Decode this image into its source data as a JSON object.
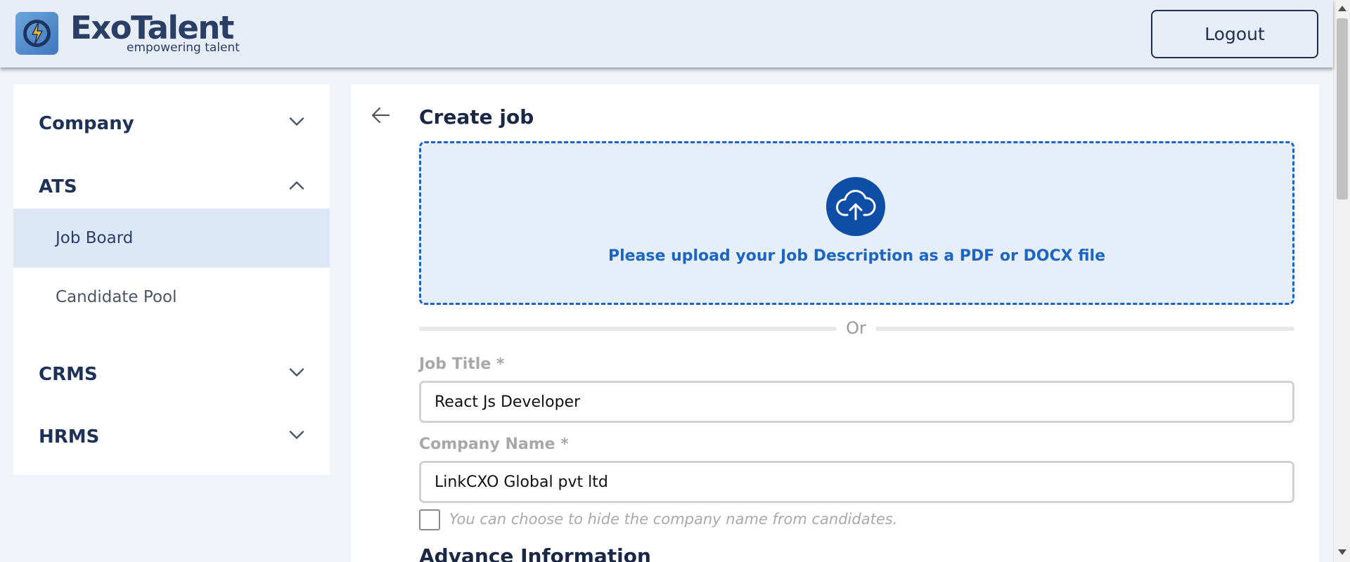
{
  "app": {
    "brand_name": "ExoTalent",
    "tagline": "empowering talent"
  },
  "header": {
    "logout_label": "Logout"
  },
  "sidebar": {
    "sections": [
      {
        "label": "Company",
        "icon": "chevron-down-icon",
        "expanded": false
      },
      {
        "label": "ATS",
        "icon": "chevron-up-icon",
        "expanded": true
      },
      {
        "label": "CRMS",
        "icon": "chevron-down-icon",
        "expanded": false
      },
      {
        "label": "HRMS",
        "icon": "chevron-down-icon",
        "expanded": false
      }
    ],
    "ats_items": [
      {
        "label": "Job Board",
        "active": true
      },
      {
        "label": "Candidate Pool",
        "active": false
      }
    ]
  },
  "main": {
    "back_icon": "back-arrow-icon",
    "title": "Create job",
    "upload": {
      "icon": "cloud-upload-icon",
      "text": "Please upload your Job Description as a PDF or DOCX file"
    },
    "divider_text": "Or",
    "fields": {
      "job_title": {
        "label": "Job Title *",
        "value": "React Js Developer"
      },
      "company_name": {
        "label": "Company Name *",
        "value": "LinkCXO Global pvt ltd"
      }
    },
    "hide_company": {
      "checked": false,
      "label": "You can choose to hide the company name from candidates."
    },
    "advance_title": "Advance Information"
  },
  "colors": {
    "header_bg": "#e6edf7",
    "primary_dark": "#1f2e52",
    "accent_blue": "#1c66c2",
    "upload_circle": "#0e4ea6",
    "active_item_bg": "#dce8f7"
  }
}
